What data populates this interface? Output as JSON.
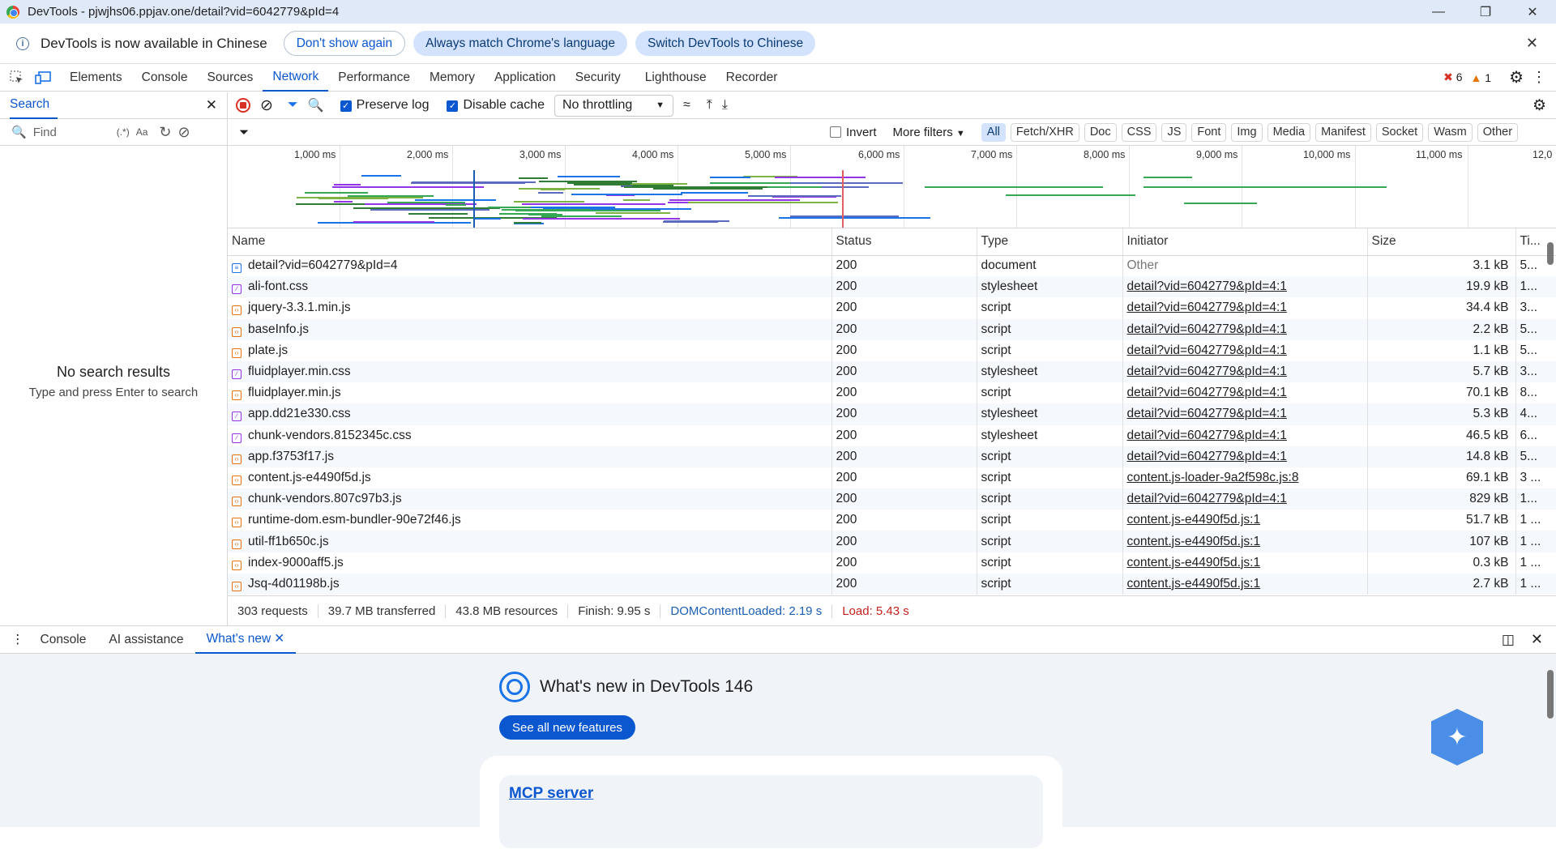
{
  "window": {
    "title": "DevTools - pjwjhs06.ppjav.one/detail?vid=6042779&pId=4"
  },
  "infobar": {
    "message": "DevTools is now available in Chinese",
    "btn1": "Don't show again",
    "btn2": "Always match Chrome's language",
    "btn3": "Switch DevTools to Chinese"
  },
  "tabs": [
    "Elements",
    "Console",
    "Sources",
    "Network",
    "Performance",
    "Memory",
    "Application",
    "Security",
    "Lighthouse",
    "Recorder"
  ],
  "counts": {
    "errors": "6",
    "warnings": "1"
  },
  "search": {
    "tab": "Search",
    "find_placeholder": "Find",
    "regex": "(.*)",
    "case": "Aa",
    "empty_title": "No search results",
    "empty_hint": "Type and press Enter to search"
  },
  "toolbar": {
    "preserve_log": "Preserve log",
    "disable_cache": "Disable cache",
    "throttling": "No throttling"
  },
  "filter": {
    "invert": "Invert",
    "more_filters": "More filters",
    "chips": [
      "All",
      "Fetch/XHR",
      "Doc",
      "CSS",
      "JS",
      "Font",
      "Img",
      "Media",
      "Manifest",
      "Socket",
      "Wasm",
      "Other"
    ]
  },
  "overview": {
    "ticks": [
      "1,000 ms",
      "2,000 ms",
      "3,000 ms",
      "4,000 ms",
      "5,000 ms",
      "6,000 ms",
      "7,000 ms",
      "8,000 ms",
      "9,000 ms",
      "10,000 ms",
      "11,000 ms",
      "12,0"
    ]
  },
  "columns": [
    "Name",
    "Status",
    "Type",
    "Initiator",
    "Size",
    "Ti..."
  ],
  "rows": [
    {
      "name": "detail?vid=6042779&pId=4",
      "kind": "doc",
      "status": "200",
      "type": "document",
      "initiator": "Other",
      "size": "3.1 kB",
      "time": "5..."
    },
    {
      "name": "ali-font.css",
      "kind": "css",
      "status": "200",
      "type": "stylesheet",
      "initiator": "detail?vid=6042779&pId=4:1",
      "size": "19.9 kB",
      "time": "1..."
    },
    {
      "name": "jquery-3.3.1.min.js",
      "kind": "js",
      "status": "200",
      "type": "script",
      "initiator": "detail?vid=6042779&pId=4:1",
      "size": "34.4 kB",
      "time": "3..."
    },
    {
      "name": "baseInfo.js",
      "kind": "js",
      "status": "200",
      "type": "script",
      "initiator": "detail?vid=6042779&pId=4:1",
      "size": "2.2 kB",
      "time": "5..."
    },
    {
      "name": "plate.js",
      "kind": "js",
      "status": "200",
      "type": "script",
      "initiator": "detail?vid=6042779&pId=4:1",
      "size": "1.1 kB",
      "time": "5..."
    },
    {
      "name": "fluidplayer.min.css",
      "kind": "css",
      "status": "200",
      "type": "stylesheet",
      "initiator": "detail?vid=6042779&pId=4:1",
      "size": "5.7 kB",
      "time": "3..."
    },
    {
      "name": "fluidplayer.min.js",
      "kind": "js",
      "status": "200",
      "type": "script",
      "initiator": "detail?vid=6042779&pId=4:1",
      "size": "70.1 kB",
      "time": "8..."
    },
    {
      "name": "app.dd21e330.css",
      "kind": "css",
      "status": "200",
      "type": "stylesheet",
      "initiator": "detail?vid=6042779&pId=4:1",
      "size": "5.3 kB",
      "time": "4..."
    },
    {
      "name": "chunk-vendors.8152345c.css",
      "kind": "css",
      "status": "200",
      "type": "stylesheet",
      "initiator": "detail?vid=6042779&pId=4:1",
      "size": "46.5 kB",
      "time": "6..."
    },
    {
      "name": "app.f3753f17.js",
      "kind": "js",
      "status": "200",
      "type": "script",
      "initiator": "detail?vid=6042779&pId=4:1",
      "size": "14.8 kB",
      "time": "5..."
    },
    {
      "name": "content.js-e4490f5d.js",
      "kind": "js",
      "status": "200",
      "type": "script",
      "initiator": "content.js-loader-9a2f598c.js:8",
      "size": "69.1 kB",
      "time": "3 ..."
    },
    {
      "name": "chunk-vendors.807c97b3.js",
      "kind": "js",
      "status": "200",
      "type": "script",
      "initiator": "detail?vid=6042779&pId=4:1",
      "size": "829 kB",
      "time": "1..."
    },
    {
      "name": "runtime-dom.esm-bundler-90e72f46.js",
      "kind": "js",
      "status": "200",
      "type": "script",
      "initiator": "content.js-e4490f5d.js:1",
      "size": "51.7 kB",
      "time": "1 ..."
    },
    {
      "name": "util-ff1b650c.js",
      "kind": "js",
      "status": "200",
      "type": "script",
      "initiator": "content.js-e4490f5d.js:1",
      "size": "107 kB",
      "time": "1 ..."
    },
    {
      "name": "index-9000aff5.js",
      "kind": "js",
      "status": "200",
      "type": "script",
      "initiator": "content.js-e4490f5d.js:1",
      "size": "0.3 kB",
      "time": "1 ..."
    },
    {
      "name": "Jsq-4d01198b.js",
      "kind": "js",
      "status": "200",
      "type": "script",
      "initiator": "content.js-e4490f5d.js:1",
      "size": "2.7 kB",
      "time": "1 ..."
    }
  ],
  "summary": {
    "requests": "303 requests",
    "transferred": "39.7 MB transferred",
    "resources": "43.8 MB resources",
    "finish": "Finish: 9.95 s",
    "dcl": "DOMContentLoaded: 2.19 s",
    "load": "Load: 5.43 s"
  },
  "drawer": {
    "tabs": [
      "Console",
      "AI assistance",
      "What's new"
    ],
    "title": "What's new in DevTools 146",
    "button": "See all new features",
    "card_link": "MCP server"
  },
  "colors": {
    "accent": "#0b57d0",
    "error": "#d93025",
    "warning": "#e37400"
  }
}
